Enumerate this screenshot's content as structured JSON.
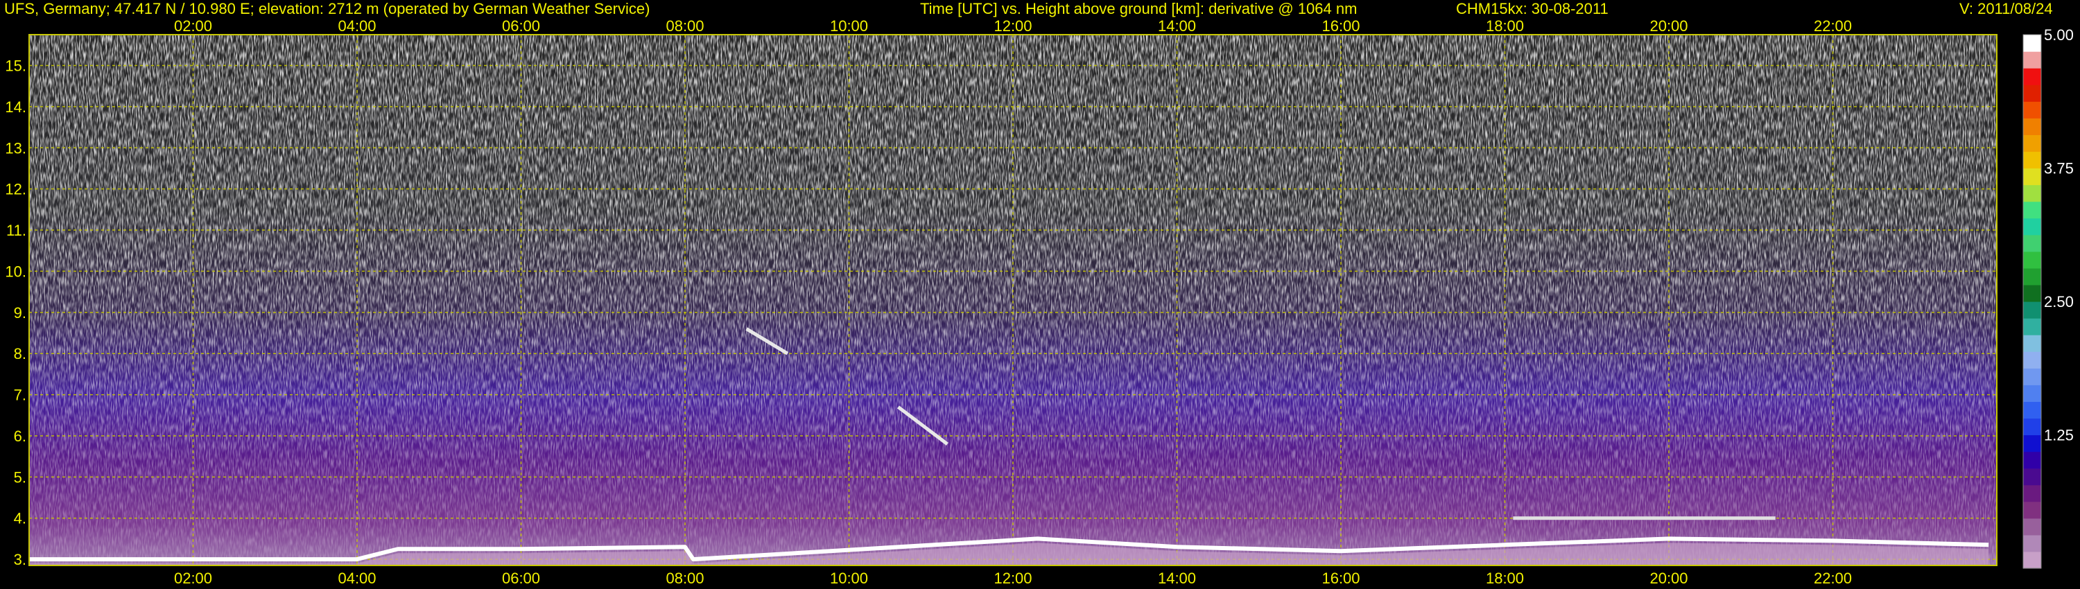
{
  "header": {
    "location": "UFS, Germany; 47.417 N / 10.980 E; elevation: 2712 m  (operated by German Weather Service)",
    "axis_desc": "Time [UTC] vs. Height above ground [km]: derivative @ 1064 nm",
    "instrument": "CHM15kx: 30-08-2011",
    "version": "V: 2011/08/24"
  },
  "colors": {
    "text": "#f2f200",
    "gridline": "#c8c800",
    "background": "#000000"
  },
  "chart_data": {
    "type": "heatmap",
    "x_ticks": [
      "02:00",
      "04:00",
      "06:00",
      "08:00",
      "10:00",
      "12:00",
      "14:00",
      "16:00",
      "18:00",
      "20:00",
      "22:00"
    ],
    "x_tick_hours": [
      2,
      4,
      6,
      8,
      10,
      12,
      14,
      16,
      18,
      20,
      22
    ],
    "xlim": [
      0,
      24
    ],
    "y_ticks": [
      "3.",
      "4.",
      "5.",
      "6.",
      "7.",
      "8.",
      "9.",
      "10.",
      "11.",
      "12.",
      "13.",
      "14.",
      "15."
    ],
    "y_tick_values": [
      3,
      4,
      5,
      6,
      7,
      8,
      9,
      10,
      11,
      12,
      13,
      14,
      15
    ],
    "ylim": [
      2.85,
      15.75
    ],
    "grid": true,
    "colorbar": {
      "labels": [
        "5.00",
        "3.75",
        "2.50",
        "1.25"
      ],
      "values": [
        5.0,
        3.75,
        2.5,
        1.25
      ],
      "range": [
        0,
        5.0
      ],
      "colors": [
        "#c8a0c8",
        "#b088b8",
        "#98609c",
        "#803080",
        "#6a1a80",
        "#4a0a90",
        "#3000a8",
        "#1010d0",
        "#2040e8",
        "#3060f0",
        "#5080f0",
        "#7098f0",
        "#90b0f0",
        "#80c0e0",
        "#30b0a0",
        "#109070",
        "#107020",
        "#20a030",
        "#30c040",
        "#40d070",
        "#20d0a0",
        "#40e080",
        "#a0e040",
        "#e0e020",
        "#f0c000",
        "#f0a000",
        "#f08000",
        "#f05000",
        "#e02000",
        "#f01010",
        "#f0a0a0",
        "#ffffff"
      ]
    },
    "features": [
      {
        "name": "boundary layer top",
        "x_hours": [
          0.0,
          4.0,
          4.5,
          6.0,
          8.0,
          8.1,
          12.3,
          14.0,
          16.0,
          18.0,
          20.0,
          22.0,
          23.9
        ],
        "y_km": [
          3.0,
          3.0,
          3.25,
          3.25,
          3.3,
          3.0,
          3.5,
          3.3,
          3.2,
          3.35,
          3.5,
          3.45,
          3.35
        ]
      },
      {
        "name": "elevated layer",
        "x_start": 18.1,
        "x_end": 21.3,
        "y_km": 4.0
      },
      {
        "name": "cloud fragment",
        "x_hours": [
          8.75,
          9.25
        ],
        "y_km": [
          8.6,
          8.0
        ]
      },
      {
        "name": "cloud fragment",
        "x_hours": [
          10.6,
          11.2
        ],
        "y_km": [
          6.7,
          5.8
        ]
      }
    ]
  }
}
